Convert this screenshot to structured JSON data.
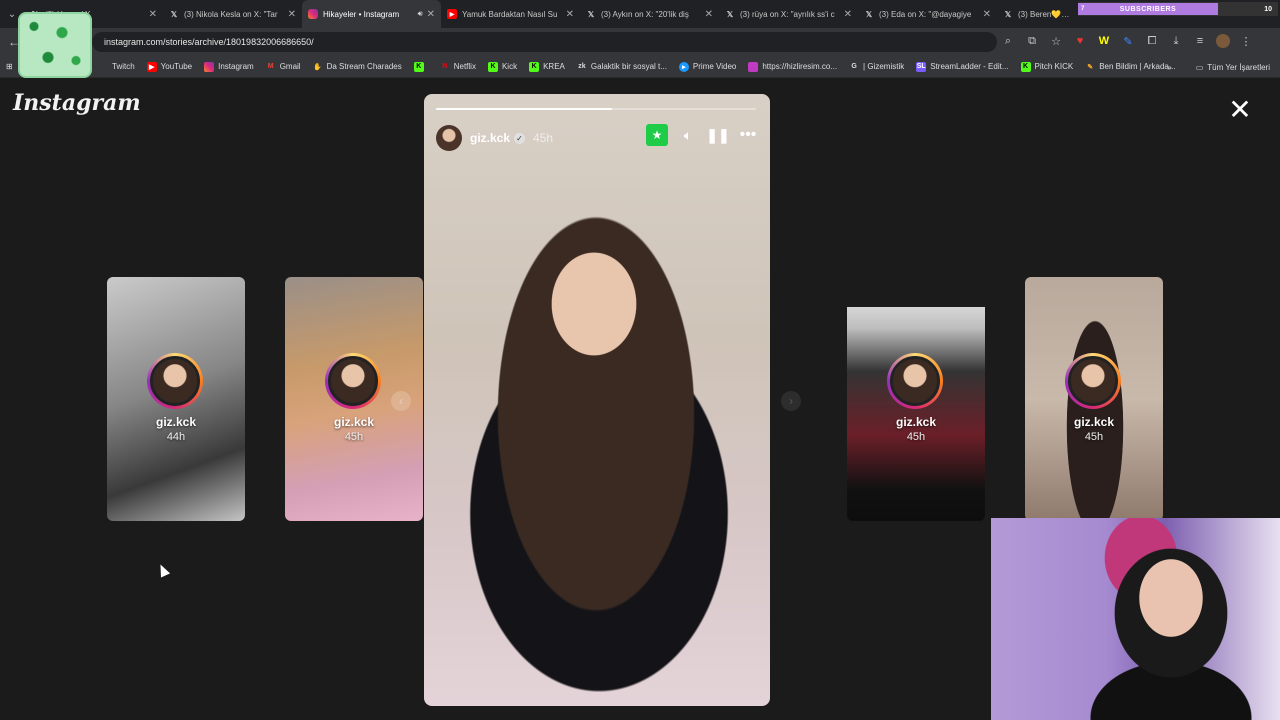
{
  "browser": {
    "tabs": [
      {
        "title": "(3) Home / X",
        "icon": "x-icon",
        "active": false
      },
      {
        "title": "(3) Nikola Kesla on X: \"Tar",
        "icon": "x-icon",
        "active": false
      },
      {
        "title": "Hikayeler • Instagram",
        "icon": "instagram-icon",
        "active": true
      },
      {
        "title": "Yamuk Bardaktan Nasıl Su",
        "icon": "youtube-icon",
        "active": false
      },
      {
        "title": "(3) Aykın on X: \"20'lik diş",
        "icon": "x-icon",
        "active": false
      },
      {
        "title": "(3) rüya on X: \"ayrılık ss'i c",
        "icon": "x-icon",
        "active": false
      },
      {
        "title": "(3) Eda on X: \"@dayagiye",
        "icon": "x-icon",
        "active": false
      },
      {
        "title": "(3) Beren💛💔 on X",
        "icon": "x-icon",
        "active": false
      }
    ],
    "url": "instagram.com/stories/archive/18019832006686650/",
    "subs_overlay": {
      "label": "SUBSCRIBERS",
      "current": "7",
      "count": "10"
    },
    "bookmarks": [
      {
        "label": "Twitch",
        "icon": "twitch-icon",
        "color": "#9146ff"
      },
      {
        "label": "YouTube",
        "icon": "youtube-icon",
        "color": "#ff0000"
      },
      {
        "label": "Instagram",
        "icon": "instagram-icon",
        "color": "#e1306c"
      },
      {
        "label": "Gmail",
        "icon": "gmail-icon",
        "color": "#ea4335"
      },
      {
        "label": "Da Stream Charades",
        "icon": "charades-icon",
        "color": "#cccccc"
      },
      {
        "label": "",
        "icon": "kick-icon",
        "color": "#53fc18"
      },
      {
        "label": "Netflix",
        "icon": "netflix-icon",
        "color": "#e50914"
      },
      {
        "label": "Kick",
        "icon": "kick-icon",
        "color": "#53fc18"
      },
      {
        "label": "KREA",
        "icon": "krea-icon",
        "color": "#53fc18"
      },
      {
        "label": "Galaktik bir sosyal t...",
        "icon": "zk-icon",
        "color": "#cccccc"
      },
      {
        "label": "Prime Video",
        "icon": "prime-icon",
        "color": "#1a98ff"
      },
      {
        "label": "https://hizliresim.co...",
        "icon": "image-icon",
        "color": "#c13ac2"
      },
      {
        "label": "| Gizemistik",
        "icon": "g-icon",
        "color": "#ffffff"
      },
      {
        "label": "StreamLadder - Edit...",
        "icon": "streamladder-icon",
        "color": "#7b5cff"
      },
      {
        "label": "Pitch KICK",
        "icon": "kick-icon",
        "color": "#53fc18"
      },
      {
        "label": "Ben Bildim | Arkada...",
        "icon": "benbildim-icon",
        "color": "#f5a623"
      }
    ],
    "bookmarks_all": "Tüm Yer İşaretleri",
    "bookmarks_more": "»"
  },
  "instagram": {
    "logo": "Instagram",
    "story": {
      "username": "giz.kck",
      "time": "45h",
      "progress": 0.55
    },
    "side_stories": [
      {
        "username": "giz.kck",
        "time": "44h"
      },
      {
        "username": "giz.kck",
        "time": "45h"
      },
      {
        "username": "giz.kck",
        "time": "45h"
      },
      {
        "username": "giz.kck",
        "time": "45h"
      }
    ]
  },
  "colors": {
    "close_friends": "#1ecc47",
    "background": "#1b1b1b",
    "subs_bar": "#b07be0"
  }
}
